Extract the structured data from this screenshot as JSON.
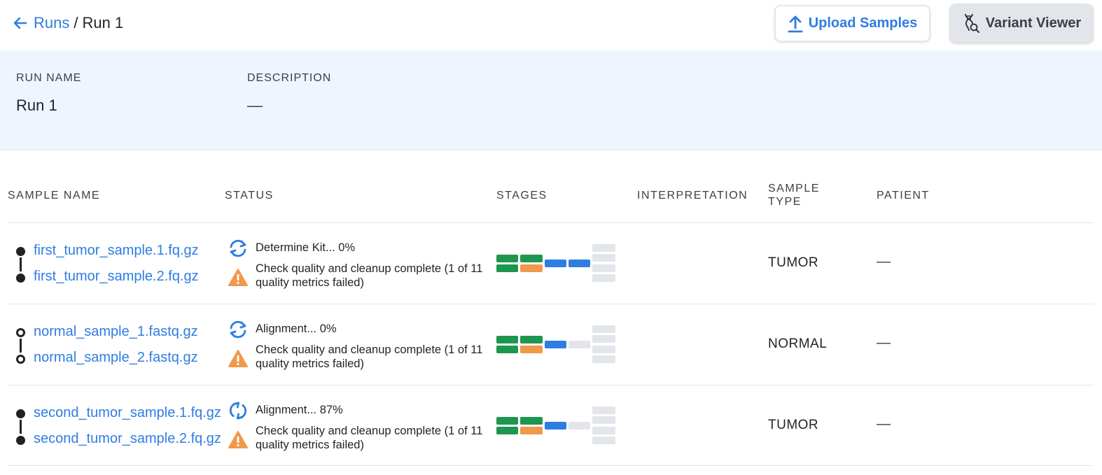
{
  "breadcrumb": {
    "root": "Runs",
    "separator": "/",
    "current": "Run 1"
  },
  "toolbar": {
    "upload_label": "Upload Samples",
    "variant_label": "Variant Viewer"
  },
  "run": {
    "name_label": "RUN NAME",
    "name_value": "Run 1",
    "description_label": "DESCRIPTION",
    "description_value": "—"
  },
  "table": {
    "headers": {
      "sample_name": "SAMPLE NAME",
      "status": "STATUS",
      "stages": "STAGES",
      "interpretation": "INTERPRETATION",
      "sample_type_1": "SAMPLE",
      "sample_type_2": "TYPE",
      "patient": "PATIENT"
    },
    "rows": [
      {
        "file_a": "first_tumor_sample.1.fq.gz",
        "file_b": "first_tumor_sample.2.fq.gz",
        "dots": "filled",
        "status_progress": "Determine Kit... 0%",
        "status_warning": "Check quality and cleanup complete (1 of 11 quality metrics failed)",
        "sample_type": "TUMOR",
        "patient": "—"
      },
      {
        "file_a": "normal_sample_1.fastq.gz",
        "file_b": "normal_sample_2.fastq.gz",
        "dots": "hollow",
        "status_progress": "Alignment... 0%",
        "status_warning": "Check quality and cleanup complete (1 of 11 quality metrics failed)",
        "sample_type": "NORMAL",
        "patient": "—"
      },
      {
        "file_a": "second_tumor_sample.1.fq.gz",
        "file_b": "second_tumor_sample.2.fq.gz",
        "dots": "filled",
        "status_progress": "Alignment... 87%",
        "status_warning": "Check quality and cleanup complete (1 of 11 quality metrics failed)",
        "sample_type": "TUMOR",
        "patient": "—"
      }
    ]
  },
  "colors": {
    "link": "#2f7de1",
    "stage_complete": "#1e9650",
    "stage_warning": "#f0994a",
    "stage_running": "#2f7de1",
    "stage_pending": "#e2e5ea",
    "warning_icon": "#f0994a"
  },
  "icons": {
    "back": "arrow-left-icon",
    "upload": "upload-icon",
    "variant": "dna-search-icon",
    "progress": "sync-icon",
    "warning": "warning-triangle-icon"
  }
}
